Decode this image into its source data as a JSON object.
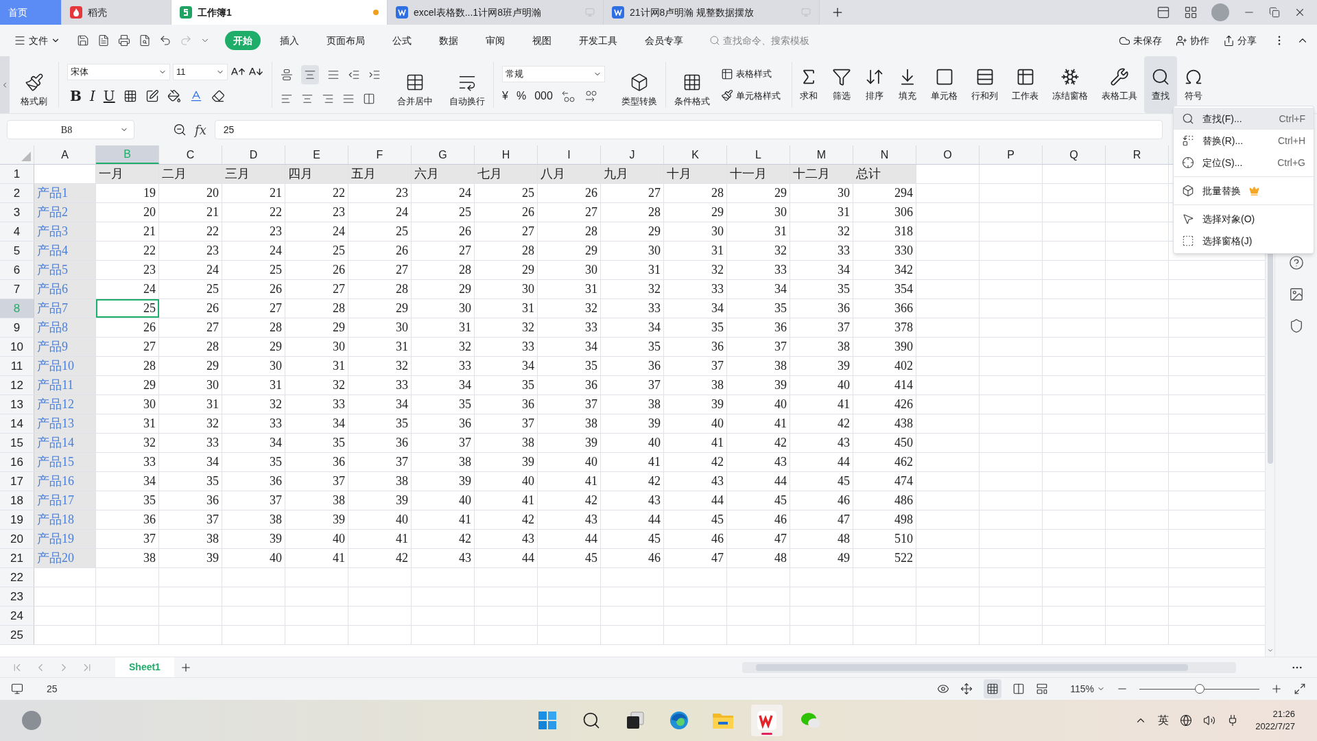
{
  "tabs": [
    {
      "label": "首页",
      "kind": "home",
      "selected": false
    },
    {
      "label": "稻壳",
      "kind": "docer",
      "selected": false
    },
    {
      "label": "工作簿1",
      "kind": "sheet",
      "selected": true,
      "unsaved": true
    },
    {
      "label": "excel表格数...1计网8班卢明瀚",
      "kind": "doc",
      "selected": false
    },
    {
      "label": "21计网8卢明瀚 规整数据摆放",
      "kind": "doc",
      "selected": false
    }
  ],
  "menu_bar": {
    "file": "文件",
    "items": [
      {
        "label": "开始",
        "selected": true
      },
      {
        "label": "插入",
        "selected": false
      },
      {
        "label": "页面布局",
        "selected": false
      },
      {
        "label": "公式",
        "selected": false
      },
      {
        "label": "数据",
        "selected": false
      },
      {
        "label": "审阅",
        "selected": false
      },
      {
        "label": "视图",
        "selected": false
      },
      {
        "label": "开发工具",
        "selected": false
      },
      {
        "label": "会员专享",
        "selected": false
      }
    ],
    "search_placeholder": "查找命令、搜索模板",
    "actions": [
      "未保存",
      "协作",
      "分享"
    ]
  },
  "ribbon": {
    "format_painter": "格式刷",
    "font": "宋体",
    "font_size": "11",
    "text_styles": [
      "B",
      "I",
      "U"
    ],
    "merge": "合并居中",
    "wrap": "自动换行",
    "number_format": "常规",
    "number_symbols": [
      "¥",
      "%",
      "000"
    ],
    "convert": "类型转换",
    "conditional": "条件格式",
    "table_style": "表格样式",
    "cell_style": "单元格样式",
    "tools": [
      {
        "label": "求和",
        "kind": "sum",
        "selected": false
      },
      {
        "label": "筛选",
        "kind": "filter",
        "selected": false
      },
      {
        "label": "排序",
        "kind": "sort",
        "selected": false
      },
      {
        "label": "填充",
        "kind": "fill",
        "selected": false
      },
      {
        "label": "单元格",
        "kind": "cell",
        "selected": false
      },
      {
        "label": "行和列",
        "kind": "rows",
        "selected": false
      },
      {
        "label": "工作表",
        "kind": "sheet",
        "selected": false
      },
      {
        "label": "冻结窗格",
        "kind": "freeze",
        "selected": false
      },
      {
        "label": "表格工具",
        "kind": "tools",
        "selected": false
      },
      {
        "label": "查找",
        "kind": "find",
        "selected": true
      },
      {
        "label": "符号",
        "kind": "symbol",
        "selected": false
      }
    ]
  },
  "formula_bar": {
    "name_box": "B8",
    "function_label": "fx",
    "value": "25"
  },
  "sheet": {
    "columns": [
      {
        "letter": "A",
        "selected": false
      },
      {
        "letter": "B",
        "selected": true
      },
      {
        "letter": "C",
        "selected": false
      },
      {
        "letter": "D",
        "selected": false
      },
      {
        "letter": "E",
        "selected": false
      },
      {
        "letter": "F",
        "selected": false
      },
      {
        "letter": "G",
        "selected": false
      },
      {
        "letter": "H",
        "selected": false
      },
      {
        "letter": "I",
        "selected": false
      },
      {
        "letter": "J",
        "selected": false
      },
      {
        "letter": "K",
        "selected": false
      },
      {
        "letter": "L",
        "selected": false
      },
      {
        "letter": "M",
        "selected": false
      },
      {
        "letter": "N",
        "selected": false
      },
      {
        "letter": "O",
        "selected": false
      },
      {
        "letter": "P",
        "selected": false
      },
      {
        "letter": "Q",
        "selected": false
      },
      {
        "letter": "R",
        "selected": false
      }
    ],
    "rows": [
      {
        "label": "1",
        "kind": "header",
        "selected": false,
        "cells": [
          "一月",
          "二月",
          "三月",
          "四月",
          "五月",
          "六月",
          "七月",
          "八月",
          "九月",
          "十月",
          "十一月",
          "十二月",
          "总计"
        ]
      },
      {
        "label": "2",
        "kind": "data",
        "selected": false,
        "cells": [
          "产品1",
          "19",
          "20",
          "21",
          "22",
          "23",
          "24",
          "25",
          "26",
          "27",
          "28",
          "29",
          "30",
          "294"
        ]
      },
      {
        "label": "3",
        "kind": "data",
        "selected": false,
        "cells": [
          "产品2",
          "20",
          "21",
          "22",
          "23",
          "24",
          "25",
          "26",
          "27",
          "28",
          "29",
          "30",
          "31",
          "306"
        ]
      },
      {
        "label": "4",
        "kind": "data",
        "selected": false,
        "cells": [
          "产品3",
          "21",
          "22",
          "23",
          "24",
          "25",
          "26",
          "27",
          "28",
          "29",
          "30",
          "31",
          "32",
          "318"
        ]
      },
      {
        "label": "5",
        "kind": "data",
        "selected": false,
        "cells": [
          "产品4",
          "22",
          "23",
          "24",
          "25",
          "26",
          "27",
          "28",
          "29",
          "30",
          "31",
          "32",
          "33",
          "330"
        ]
      },
      {
        "label": "6",
        "kind": "data",
        "selected": false,
        "cells": [
          "产品5",
          "23",
          "24",
          "25",
          "26",
          "27",
          "28",
          "29",
          "30",
          "31",
          "32",
          "33",
          "34",
          "342"
        ]
      },
      {
        "label": "7",
        "kind": "data",
        "selected": false,
        "cells": [
          "产品6",
          "24",
          "25",
          "26",
          "27",
          "28",
          "29",
          "30",
          "31",
          "32",
          "33",
          "34",
          "35",
          "354"
        ]
      },
      {
        "label": "8",
        "kind": "data",
        "selected": true,
        "cells": [
          "产品7",
          "25",
          "26",
          "27",
          "28",
          "29",
          "30",
          "31",
          "32",
          "33",
          "34",
          "35",
          "36",
          "366"
        ]
      },
      {
        "label": "9",
        "kind": "data",
        "selected": false,
        "cells": [
          "产品8",
          "26",
          "27",
          "28",
          "29",
          "30",
          "31",
          "32",
          "33",
          "34",
          "35",
          "36",
          "37",
          "378"
        ]
      },
      {
        "label": "10",
        "kind": "data",
        "selected": false,
        "cells": [
          "产品9",
          "27",
          "28",
          "29",
          "30",
          "31",
          "32",
          "33",
          "34",
          "35",
          "36",
          "37",
          "38",
          "390"
        ]
      },
      {
        "label": "11",
        "kind": "data",
        "selected": false,
        "cells": [
          "产品10",
          "28",
          "29",
          "30",
          "31",
          "32",
          "33",
          "34",
          "35",
          "36",
          "37",
          "38",
          "39",
          "402"
        ]
      },
      {
        "label": "12",
        "kind": "data",
        "selected": false,
        "cells": [
          "产品11",
          "29",
          "30",
          "31",
          "32",
          "33",
          "34",
          "35",
          "36",
          "37",
          "38",
          "39",
          "40",
          "414"
        ]
      },
      {
        "label": "13",
        "kind": "data",
        "selected": false,
        "cells": [
          "产品12",
          "30",
          "31",
          "32",
          "33",
          "34",
          "35",
          "36",
          "37",
          "38",
          "39",
          "40",
          "41",
          "426"
        ]
      },
      {
        "label": "14",
        "kind": "data",
        "selected": false,
        "cells": [
          "产品13",
          "31",
          "32",
          "33",
          "34",
          "35",
          "36",
          "37",
          "38",
          "39",
          "40",
          "41",
          "42",
          "438"
        ]
      },
      {
        "label": "15",
        "kind": "data",
        "selected": false,
        "cells": [
          "产品14",
          "32",
          "33",
          "34",
          "35",
          "36",
          "37",
          "38",
          "39",
          "40",
          "41",
          "42",
          "43",
          "450"
        ]
      },
      {
        "label": "16",
        "kind": "data",
        "selected": false,
        "cells": [
          "产品15",
          "33",
          "34",
          "35",
          "36",
          "37",
          "38",
          "39",
          "40",
          "41",
          "42",
          "43",
          "44",
          "462"
        ]
      },
      {
        "label": "17",
        "kind": "data",
        "selected": false,
        "cells": [
          "产品16",
          "34",
          "35",
          "36",
          "37",
          "38",
          "39",
          "40",
          "41",
          "42",
          "43",
          "44",
          "45",
          "474"
        ]
      },
      {
        "label": "18",
        "kind": "data",
        "selected": false,
        "cells": [
          "产品17",
          "35",
          "36",
          "37",
          "38",
          "39",
          "40",
          "41",
          "42",
          "43",
          "44",
          "45",
          "46",
          "486"
        ]
      },
      {
        "label": "19",
        "kind": "data",
        "selected": false,
        "cells": [
          "产品18",
          "36",
          "37",
          "38",
          "39",
          "40",
          "41",
          "42",
          "43",
          "44",
          "45",
          "46",
          "47",
          "498"
        ]
      },
      {
        "label": "20",
        "kind": "data",
        "selected": false,
        "cells": [
          "产品19",
          "37",
          "38",
          "39",
          "40",
          "41",
          "42",
          "43",
          "44",
          "45",
          "46",
          "47",
          "48",
          "510"
        ]
      },
      {
        "label": "21",
        "kind": "data",
        "selected": false,
        "cells": [
          "产品20",
          "38",
          "39",
          "40",
          "41",
          "42",
          "43",
          "44",
          "45",
          "46",
          "47",
          "48",
          "49",
          "522"
        ]
      },
      {
        "label": "22",
        "kind": "empty",
        "selected": false
      },
      {
        "label": "23",
        "kind": "empty",
        "selected": false
      },
      {
        "label": "24",
        "kind": "empty",
        "selected": false
      },
      {
        "label": "25",
        "kind": "empty",
        "selected": false
      }
    ]
  },
  "find_menu": {
    "items": [
      {
        "label": "查找(F)...",
        "shortcut": "Ctrl+F",
        "kind": "find",
        "selected": true
      },
      {
        "label": "替换(R)...",
        "shortcut": "Ctrl+H",
        "kind": "replace",
        "selected": false
      },
      {
        "label": "定位(S)...",
        "shortcut": "Ctrl+G",
        "kind": "goto",
        "selected": false
      },
      {
        "label": "批量替换",
        "kind": "batch",
        "selected": false,
        "premium": true,
        "separator_before": true
      },
      {
        "label": "选择对象(O)",
        "kind": "select_object",
        "selected": false,
        "separator_before": true
      },
      {
        "label": "选择窗格(J)",
        "kind": "select_pane",
        "selected": false
      }
    ]
  },
  "sheet_tabs": [
    {
      "label": "Sheet1",
      "selected": true
    }
  ],
  "status_bar": {
    "value": "25",
    "zoom": "115%",
    "zoom_slider": {
      "level": 0.5
    }
  },
  "taskbar": {
    "apps": [
      {
        "kind": "start",
        "selected": false
      },
      {
        "kind": "search",
        "selected": false
      },
      {
        "kind": "taskview",
        "selected": false
      },
      {
        "kind": "browser",
        "selected": false
      },
      {
        "kind": "files",
        "selected": false
      },
      {
        "kind": "wps",
        "selected": true
      },
      {
        "kind": "chat",
        "selected": false
      }
    ],
    "language": "英",
    "time": "21:26",
    "date": "2022/7/27"
  }
}
